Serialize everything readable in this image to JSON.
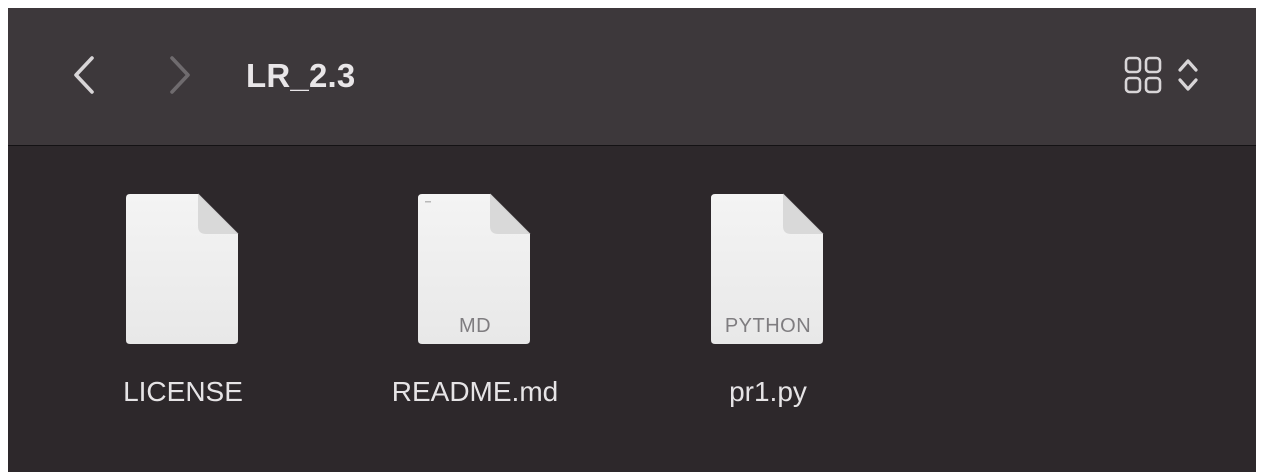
{
  "window": {
    "title": "LR_2.3"
  },
  "toolbar": {
    "back_icon": "chevron-left-icon",
    "forward_icon": "chevron-right-icon",
    "view_icon": "grid-view-icon",
    "view_toggle_icon": "up-down-chevron-icon"
  },
  "files": [
    {
      "name": "LICENSE",
      "ext_label": ""
    },
    {
      "name": "README.md",
      "ext_label": "MD"
    },
    {
      "name": "pr1.py",
      "ext_label": "PYTHON"
    }
  ],
  "colors": {
    "toolbar_bg": "#3d383b",
    "content_bg": "#2d282b",
    "text": "#e6e4e6"
  }
}
